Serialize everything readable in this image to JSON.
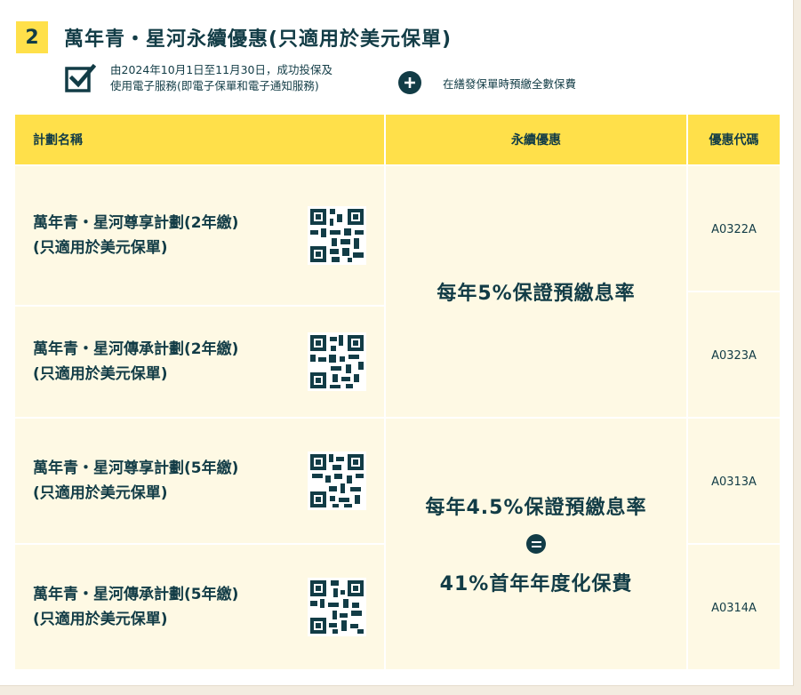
{
  "section": {
    "number": "2",
    "title": "萬年青・星河永續優惠(只適用於美元保單)"
  },
  "conditions": {
    "left_line1": "由2024年10月1日至11月30日，成功投保及",
    "left_line2": "使用電子服務(即電子保單和電子通知服務)",
    "right": "在繕發保單時預繳全數保費"
  },
  "table": {
    "headers": {
      "plan": "計劃名稱",
      "benefit": "永續優惠",
      "code": "優惠代碼"
    },
    "rows": [
      {
        "name": "萬年青・星河尊享計劃(2年繳)\n(只適用於美元保單)",
        "code": "A0322A"
      },
      {
        "name": "萬年青・星河傳承計劃(2年繳)\n(只適用於美元保單)",
        "code": "A0323A"
      },
      {
        "name": "萬年青・星河尊享計劃(5年繳)\n(只適用於美元保單)",
        "code": "A0313A"
      },
      {
        "name": "萬年青・星河傳承計劃(5年繳)\n(只適用於美元保單)",
        "code": "A0314A"
      }
    ],
    "benefit_group1": {
      "line1": "每年5%保證預繳息率"
    },
    "benefit_group2": {
      "line1": "每年4.5%保證預繳息率",
      "line2": "41%首年年度化保費"
    }
  },
  "colors": {
    "accent": "#ffe04a",
    "text": "#123c46",
    "row_bg": "#fef9e4"
  },
  "icons": {
    "check": "checkbox-check-icon",
    "plus": "plus-circle-icon",
    "equals": "equals-circle-icon",
    "qr": "qr-code-icon"
  }
}
